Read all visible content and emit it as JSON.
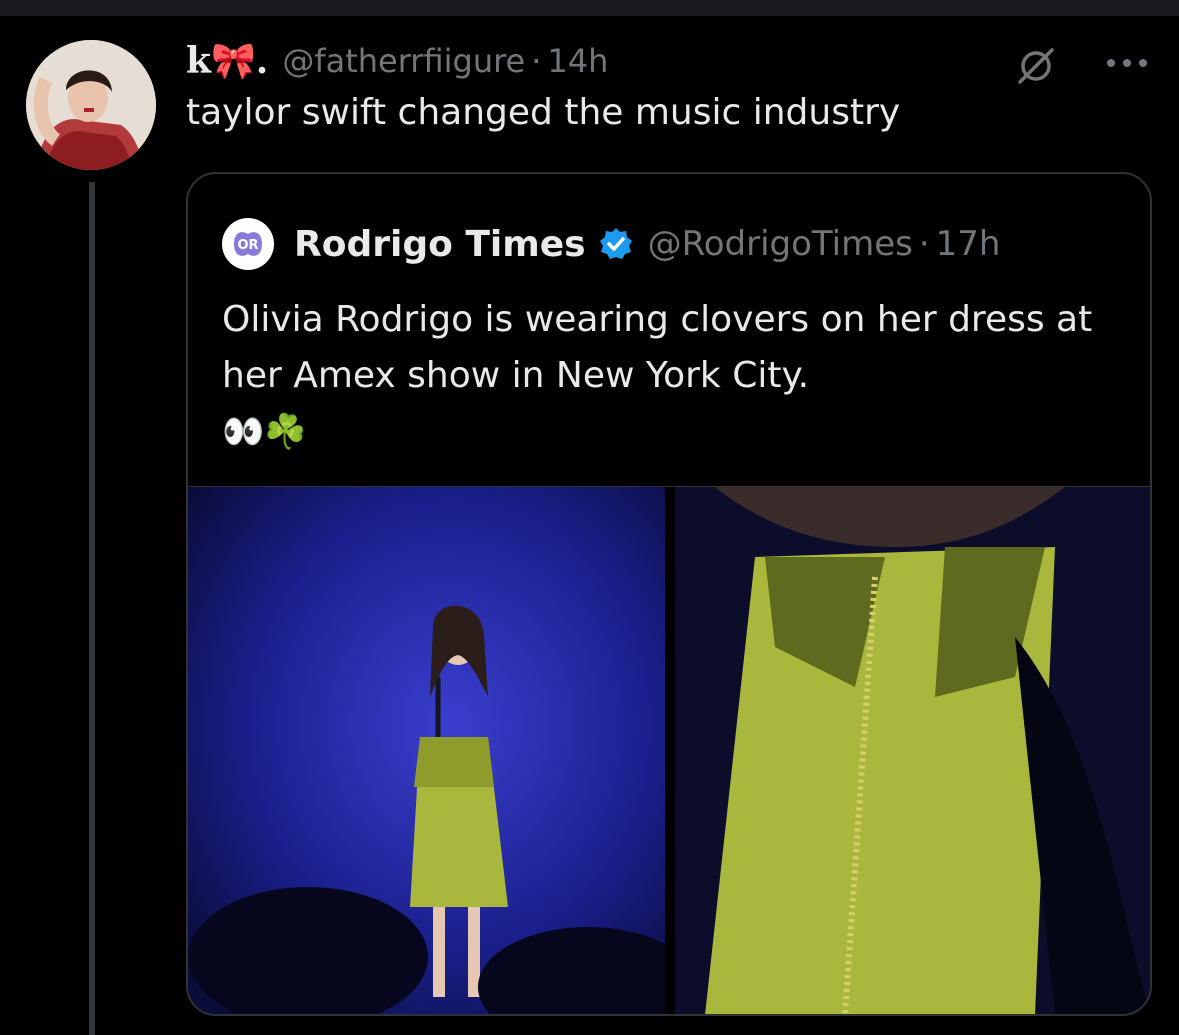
{
  "tweet": {
    "display_name": "k🎀.",
    "handle": "@fatherrfiigure",
    "separator": "·",
    "time": "14h",
    "text": "taylor swift changed the music industry",
    "avatar_icon": "user-avatar-photo",
    "grok_icon": "grok-slash-icon",
    "more_icon": "more-options-icon"
  },
  "quote": {
    "display_name": "Rodrigo Times",
    "avatar_label": "OR",
    "verified_icon": "verified-badge-icon",
    "handle": "@RodrigoTimes",
    "separator": "·",
    "time": "17h",
    "text": "Olivia Rodrigo is wearing clovers on her dress at her Amex show in New York City.",
    "emoji": "👀☘️",
    "media": [
      {
        "name": "concert-stage-photo"
      },
      {
        "name": "dress-closeup-photo"
      }
    ]
  },
  "colors": {
    "background": "#000000",
    "text_primary": "#e7e9ea",
    "text_secondary": "#71767b",
    "border": "#2f3336",
    "verified": "#1d9bf0",
    "dress_green": "#a9b83c",
    "stage_blue": "#1a1f8c"
  }
}
